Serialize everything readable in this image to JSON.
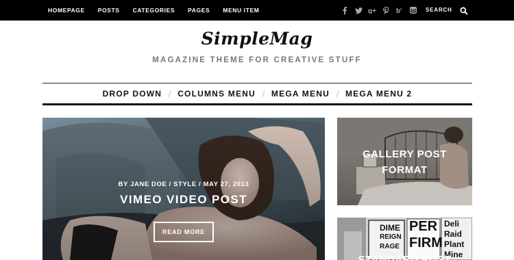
{
  "topbar": {
    "nav": [
      "HOMEPAGE",
      "POSTS",
      "CATEGORIES",
      "PAGES",
      "MENU ITEM"
    ],
    "social_icons": [
      "facebook-icon",
      "twitter-icon",
      "google-plus-icon",
      "pinterest-icon",
      "behance-icon",
      "instagram-icon"
    ],
    "search_label": "SEARCH",
    "search_icon": "search-icon"
  },
  "header": {
    "logo": "SimpleMag",
    "tagline": "MAGAZINE THEME FOR CREATIVE STUFF"
  },
  "main_nav": [
    "DROP DOWN",
    "COLUMNS MENU",
    "MEGA MENU",
    "MEGA MENU 2"
  ],
  "feature": {
    "meta": "BY JANE DOE / STYLE / MAY 27, 2013",
    "title": "VIMEO VIDEO POST",
    "button": "READ MORE"
  },
  "side_cards": [
    {
      "title_line1": "GALLERY POST",
      "title_line2": "FORMAT"
    },
    {
      "title": "STANDARD POST",
      "signs": [
        "DIME",
        "REIGN",
        "RAGE",
        "PER",
        "FIRM",
        "Deli",
        "Raid",
        "Plant",
        "Mine"
      ]
    }
  ],
  "colors": {
    "topbar_bg": "#000000",
    "accent": "#111111",
    "tagline": "#777777"
  }
}
